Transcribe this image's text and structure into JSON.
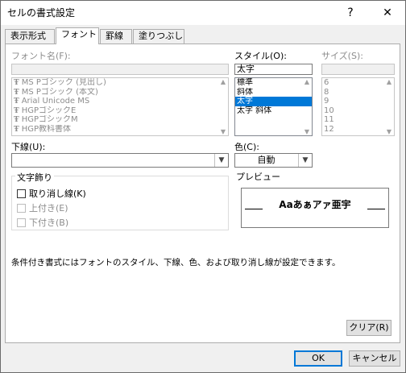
{
  "window": {
    "title": "セルの書式設定",
    "help_label": "?",
    "close_label": "✕"
  },
  "tabs": [
    {
      "label": "表示形式"
    },
    {
      "label": "フォント"
    },
    {
      "label": "罫線"
    },
    {
      "label": "塗りつぶし"
    }
  ],
  "font_name": {
    "label": "フォント名(F):",
    "value": "",
    "items": [
      "MS Pゴシック (見出し)",
      "MS Pゴシック (本文)",
      "Arial Unicode MS",
      "HGPゴシックE",
      "HGPゴシックM",
      "HGP教科書体"
    ]
  },
  "style": {
    "label": "スタイル(O):",
    "value": "太字",
    "items": [
      "標準",
      "斜体",
      "太字",
      "太字 斜体"
    ],
    "selected_index": 2
  },
  "size": {
    "label": "サイズ(S):",
    "value": "",
    "items": [
      "6",
      "8",
      "9",
      "10",
      "11",
      "12"
    ]
  },
  "underline": {
    "label": "下線(U):",
    "value": ""
  },
  "color": {
    "label": "色(C):",
    "value": "自動"
  },
  "effects": {
    "title": "文字飾り",
    "strikethrough": "取り消し線(K)",
    "superscript": "上付き(E)",
    "subscript": "下付き(B)"
  },
  "preview": {
    "title": "プレビュー",
    "sample": "Aaあぁアァ亜宇"
  },
  "note": "条件付き書式にはフォントのスタイル、下線、色、および取り消し線が設定できます。",
  "buttons": {
    "clear": "クリア(R)",
    "ok": "OK",
    "cancel": "キャンセル"
  },
  "icons": {
    "truetype": "truetype-font-icon",
    "font_glyph": "Ŧ"
  }
}
